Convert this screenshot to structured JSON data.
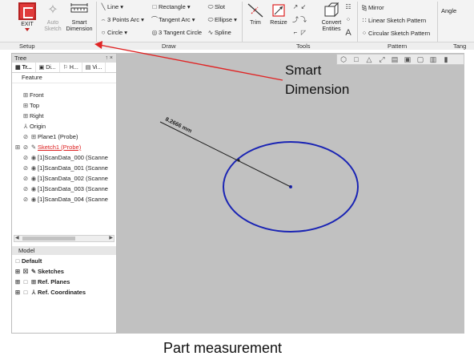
{
  "ribbon": {
    "exit_label": "EXIT",
    "auto_sketch_label": "Auto Sketch",
    "smart_dimension_label": "Smart Dimension",
    "draw": {
      "line": "Line",
      "three_points_arc": "3 Points Arc",
      "circle": "Circle",
      "rectangle": "Rectangle",
      "tangent_arc": "Tangent Arc",
      "three_tangent_circle": "3 Tangent Circle",
      "slot": "Slot",
      "ellipse": "Ellipse",
      "spline": "Spline"
    },
    "tools": {
      "trim": "Trim",
      "resize": "Resize",
      "convert_entities": "Convert Entities"
    },
    "pattern": {
      "mirror": "Mirror",
      "linear": "Linear Sketch Pattern",
      "circular": "Circular Sketch Pattern"
    },
    "angle_label": "Angle",
    "groups": {
      "setup": "Setup",
      "draw": "Draw",
      "tools": "Tools",
      "pattern": "Pattern",
      "tangent_cut": "Tang"
    }
  },
  "tree": {
    "title": "Tree",
    "pins": "↑ ×",
    "tabs": [
      "Tr...",
      "Di...",
      "H...",
      "Vi..."
    ],
    "feature_header": "Feature",
    "items": [
      "Front",
      "Top",
      "Right",
      "Origin",
      "Plane1 (Probe)",
      "Sketch1 (Probe)",
      "[1]ScanData_000 (Scanne",
      "[1]ScanData_001 (Scanne",
      "[1]ScanData_002 (Scanne",
      "[1]ScanData_003 (Scanne",
      "[1]ScanData_004 (Scanne"
    ]
  },
  "model": {
    "header": "Model",
    "items": [
      "Default",
      "Sketches",
      "Ref. Planes",
      "Ref. Coordinates"
    ]
  },
  "canvas": {
    "dimension_text": "8.2666 mm",
    "ellipse_color": "#1a24b4",
    "leader_color": "#222222"
  },
  "annotation": {
    "line1": "Smart",
    "line2": "Dimension",
    "arrow_color": "#e02424"
  },
  "caption": "Part measurement"
}
